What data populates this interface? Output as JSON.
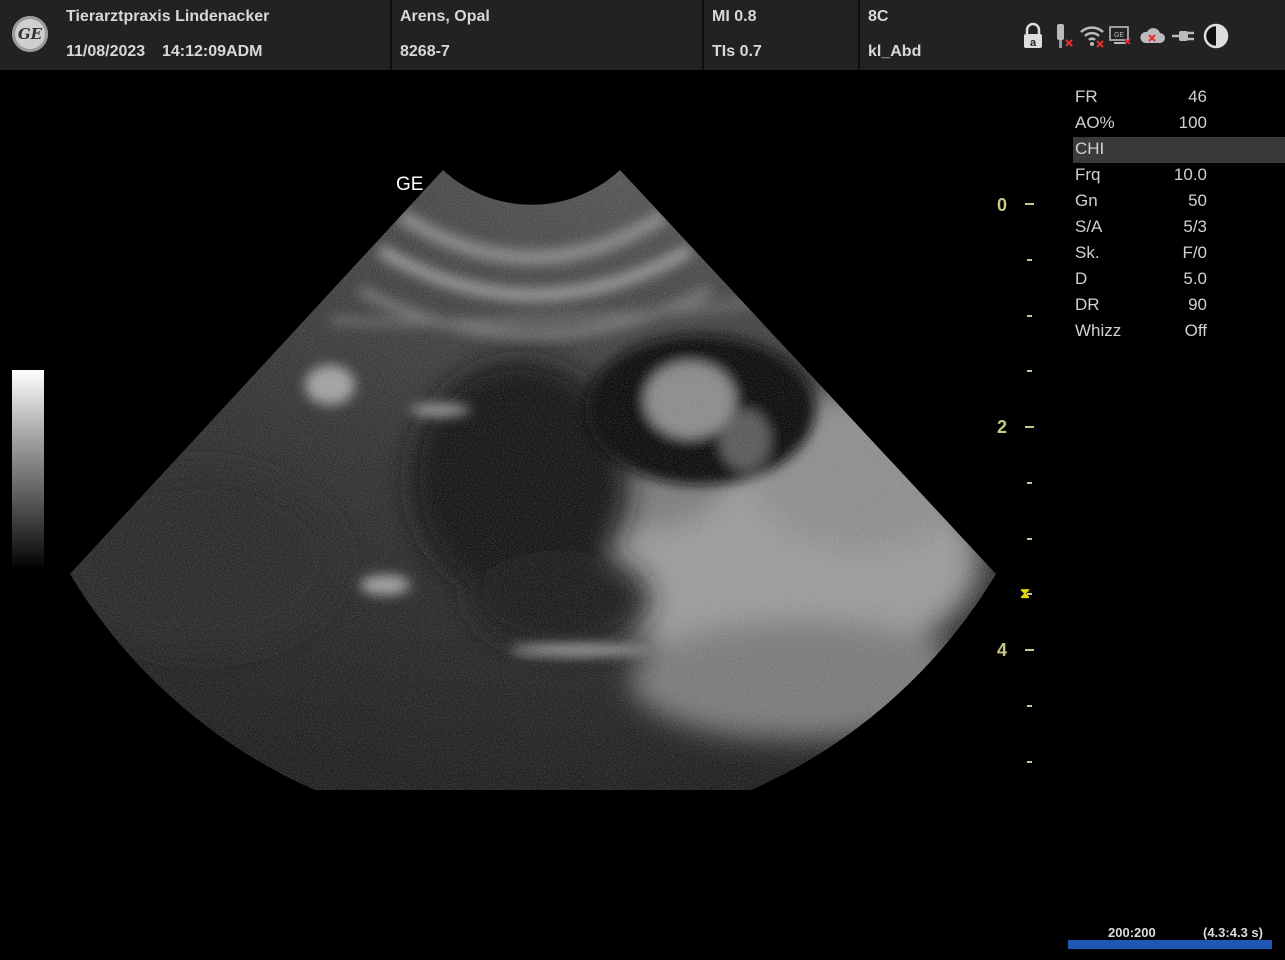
{
  "header": {
    "clinic": "Tierarztpraxis Lindenacker",
    "date": "11/08/2023",
    "time": "14:12:09ADM",
    "patient_name": "Arens, Opal",
    "patient_id": "8268-7",
    "mi": "MI 0.8",
    "tis": "TIs 0.7",
    "probe": "8C",
    "preset": "kl_Abd",
    "logo_text": "GE",
    "status_icons": [
      "lock-icon",
      "probe-disconnected-icon",
      "wifi-disconnected-icon",
      "network-icon",
      "cloud-disconnected-icon",
      "power-plug-icon",
      "contrast-icon"
    ]
  },
  "image": {
    "vendor_label": "GE"
  },
  "depth_scale": {
    "labels": [
      "0",
      "2",
      "4"
    ],
    "unit_cm_max": 5.0,
    "focus_depth_cm": 3.5,
    "color": "#c8c88a"
  },
  "params": [
    {
      "key": "FR",
      "value": "46"
    },
    {
      "key": "AO%",
      "value": "100"
    },
    {
      "key": "CHI",
      "value": "",
      "highlight": true
    },
    {
      "key": "Frq",
      "value": "10.0"
    },
    {
      "key": "Gn",
      "value": "50"
    },
    {
      "key": "S/A",
      "value": "5/3"
    },
    {
      "key": "Sk.",
      "value": "F/0"
    },
    {
      "key": "D",
      "value": "5.0"
    },
    {
      "key": "DR",
      "value": "90"
    },
    {
      "key": "Whizz",
      "value": "Off"
    }
  ],
  "cine": {
    "frames": "200:200",
    "time": "(4.3:4.3 s)",
    "progress": 1.0,
    "color": "#1f57b5"
  }
}
